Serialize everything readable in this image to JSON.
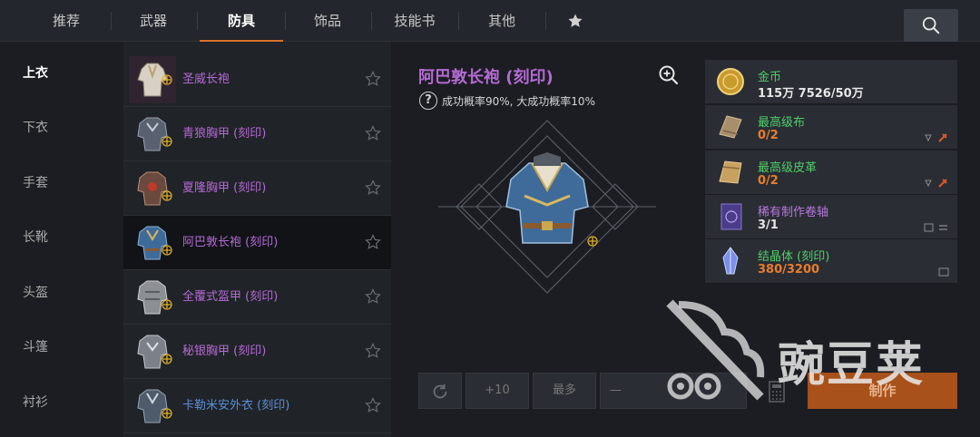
{
  "tabs": [
    {
      "label": "推荐"
    },
    {
      "label": "武器"
    },
    {
      "label": "防具"
    },
    {
      "label": "饰品"
    },
    {
      "label": "技能书"
    },
    {
      "label": "其他"
    }
  ],
  "categories": [
    {
      "label": "上衣"
    },
    {
      "label": "下衣"
    },
    {
      "label": "手套"
    },
    {
      "label": "长靴"
    },
    {
      "label": "头盔"
    },
    {
      "label": "斗篷"
    },
    {
      "label": "衬衫"
    }
  ],
  "items": [
    {
      "name": "圣威长袍"
    },
    {
      "name": "青狼胸甲 (刻印)"
    },
    {
      "name": "夏隆胸甲 (刻印)"
    },
    {
      "name": "阿巴敦长袍 (刻印)"
    },
    {
      "name": "全覆式盔甲 (刻印)"
    },
    {
      "name": "秘银胸甲 (刻印)"
    },
    {
      "name": "卡勒米安外衣 (刻印)"
    }
  ],
  "detail": {
    "title": "阿巴敦长袍 (刻印)",
    "probability": "成功概率90%, 大成功概率10%"
  },
  "materials": [
    {
      "name": "金币",
      "count": "115万 7526/50万"
    },
    {
      "name": "最高级布",
      "count": "0/2"
    },
    {
      "name": "最高级皮革",
      "count": "0/2"
    },
    {
      "name": "稀有制作卷轴",
      "count": "3/1"
    },
    {
      "name": "结晶体 (刻印)",
      "count": "380/3200"
    }
  ],
  "controls": {
    "plus10": "+10",
    "max": "最多",
    "minus": "—",
    "craft": "制作"
  },
  "watermark": {
    "text": "豌豆荚"
  },
  "colors": {
    "accent": "#d9742b",
    "purple": "#b46ad4",
    "blue": "#5b8fd6",
    "green": "#4fcf6a",
    "orange": "#e87e2c"
  }
}
